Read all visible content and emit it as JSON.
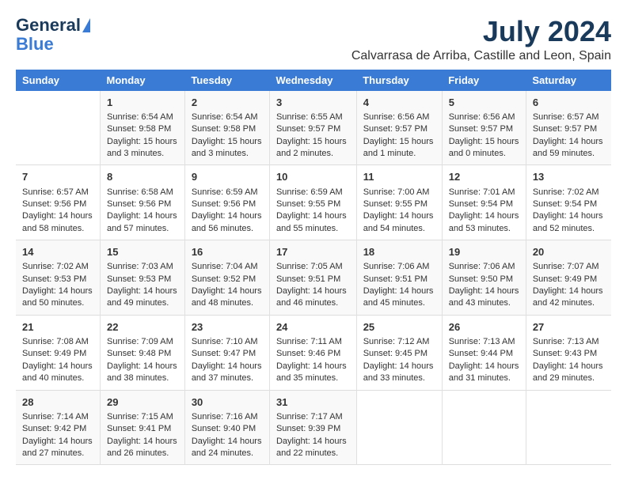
{
  "header": {
    "logo_general": "General",
    "logo_blue": "Blue",
    "month_year": "July 2024",
    "location": "Calvarrasa de Arriba, Castille and Leon, Spain"
  },
  "columns": [
    "Sunday",
    "Monday",
    "Tuesday",
    "Wednesday",
    "Thursday",
    "Friday",
    "Saturday"
  ],
  "weeks": [
    [
      {
        "day": "",
        "content": ""
      },
      {
        "day": "1",
        "content": "Sunrise: 6:54 AM\nSunset: 9:58 PM\nDaylight: 15 hours\nand 3 minutes."
      },
      {
        "day": "2",
        "content": "Sunrise: 6:54 AM\nSunset: 9:58 PM\nDaylight: 15 hours\nand 3 minutes."
      },
      {
        "day": "3",
        "content": "Sunrise: 6:55 AM\nSunset: 9:57 PM\nDaylight: 15 hours\nand 2 minutes."
      },
      {
        "day": "4",
        "content": "Sunrise: 6:56 AM\nSunset: 9:57 PM\nDaylight: 15 hours\nand 1 minute."
      },
      {
        "day": "5",
        "content": "Sunrise: 6:56 AM\nSunset: 9:57 PM\nDaylight: 15 hours\nand 0 minutes."
      },
      {
        "day": "6",
        "content": "Sunrise: 6:57 AM\nSunset: 9:57 PM\nDaylight: 14 hours\nand 59 minutes."
      }
    ],
    [
      {
        "day": "7",
        "content": "Sunrise: 6:57 AM\nSunset: 9:56 PM\nDaylight: 14 hours\nand 58 minutes."
      },
      {
        "day": "8",
        "content": "Sunrise: 6:58 AM\nSunset: 9:56 PM\nDaylight: 14 hours\nand 57 minutes."
      },
      {
        "day": "9",
        "content": "Sunrise: 6:59 AM\nSunset: 9:56 PM\nDaylight: 14 hours\nand 56 minutes."
      },
      {
        "day": "10",
        "content": "Sunrise: 6:59 AM\nSunset: 9:55 PM\nDaylight: 14 hours\nand 55 minutes."
      },
      {
        "day": "11",
        "content": "Sunrise: 7:00 AM\nSunset: 9:55 PM\nDaylight: 14 hours\nand 54 minutes."
      },
      {
        "day": "12",
        "content": "Sunrise: 7:01 AM\nSunset: 9:54 PM\nDaylight: 14 hours\nand 53 minutes."
      },
      {
        "day": "13",
        "content": "Sunrise: 7:02 AM\nSunset: 9:54 PM\nDaylight: 14 hours\nand 52 minutes."
      }
    ],
    [
      {
        "day": "14",
        "content": "Sunrise: 7:02 AM\nSunset: 9:53 PM\nDaylight: 14 hours\nand 50 minutes."
      },
      {
        "day": "15",
        "content": "Sunrise: 7:03 AM\nSunset: 9:53 PM\nDaylight: 14 hours\nand 49 minutes."
      },
      {
        "day": "16",
        "content": "Sunrise: 7:04 AM\nSunset: 9:52 PM\nDaylight: 14 hours\nand 48 minutes."
      },
      {
        "day": "17",
        "content": "Sunrise: 7:05 AM\nSunset: 9:51 PM\nDaylight: 14 hours\nand 46 minutes."
      },
      {
        "day": "18",
        "content": "Sunrise: 7:06 AM\nSunset: 9:51 PM\nDaylight: 14 hours\nand 45 minutes."
      },
      {
        "day": "19",
        "content": "Sunrise: 7:06 AM\nSunset: 9:50 PM\nDaylight: 14 hours\nand 43 minutes."
      },
      {
        "day": "20",
        "content": "Sunrise: 7:07 AM\nSunset: 9:49 PM\nDaylight: 14 hours\nand 42 minutes."
      }
    ],
    [
      {
        "day": "21",
        "content": "Sunrise: 7:08 AM\nSunset: 9:49 PM\nDaylight: 14 hours\nand 40 minutes."
      },
      {
        "day": "22",
        "content": "Sunrise: 7:09 AM\nSunset: 9:48 PM\nDaylight: 14 hours\nand 38 minutes."
      },
      {
        "day": "23",
        "content": "Sunrise: 7:10 AM\nSunset: 9:47 PM\nDaylight: 14 hours\nand 37 minutes."
      },
      {
        "day": "24",
        "content": "Sunrise: 7:11 AM\nSunset: 9:46 PM\nDaylight: 14 hours\nand 35 minutes."
      },
      {
        "day": "25",
        "content": "Sunrise: 7:12 AM\nSunset: 9:45 PM\nDaylight: 14 hours\nand 33 minutes."
      },
      {
        "day": "26",
        "content": "Sunrise: 7:13 AM\nSunset: 9:44 PM\nDaylight: 14 hours\nand 31 minutes."
      },
      {
        "day": "27",
        "content": "Sunrise: 7:13 AM\nSunset: 9:43 PM\nDaylight: 14 hours\nand 29 minutes."
      }
    ],
    [
      {
        "day": "28",
        "content": "Sunrise: 7:14 AM\nSunset: 9:42 PM\nDaylight: 14 hours\nand 27 minutes."
      },
      {
        "day": "29",
        "content": "Sunrise: 7:15 AM\nSunset: 9:41 PM\nDaylight: 14 hours\nand 26 minutes."
      },
      {
        "day": "30",
        "content": "Sunrise: 7:16 AM\nSunset: 9:40 PM\nDaylight: 14 hours\nand 24 minutes."
      },
      {
        "day": "31",
        "content": "Sunrise: 7:17 AM\nSunset: 9:39 PM\nDaylight: 14 hours\nand 22 minutes."
      },
      {
        "day": "",
        "content": ""
      },
      {
        "day": "",
        "content": ""
      },
      {
        "day": "",
        "content": ""
      }
    ]
  ]
}
